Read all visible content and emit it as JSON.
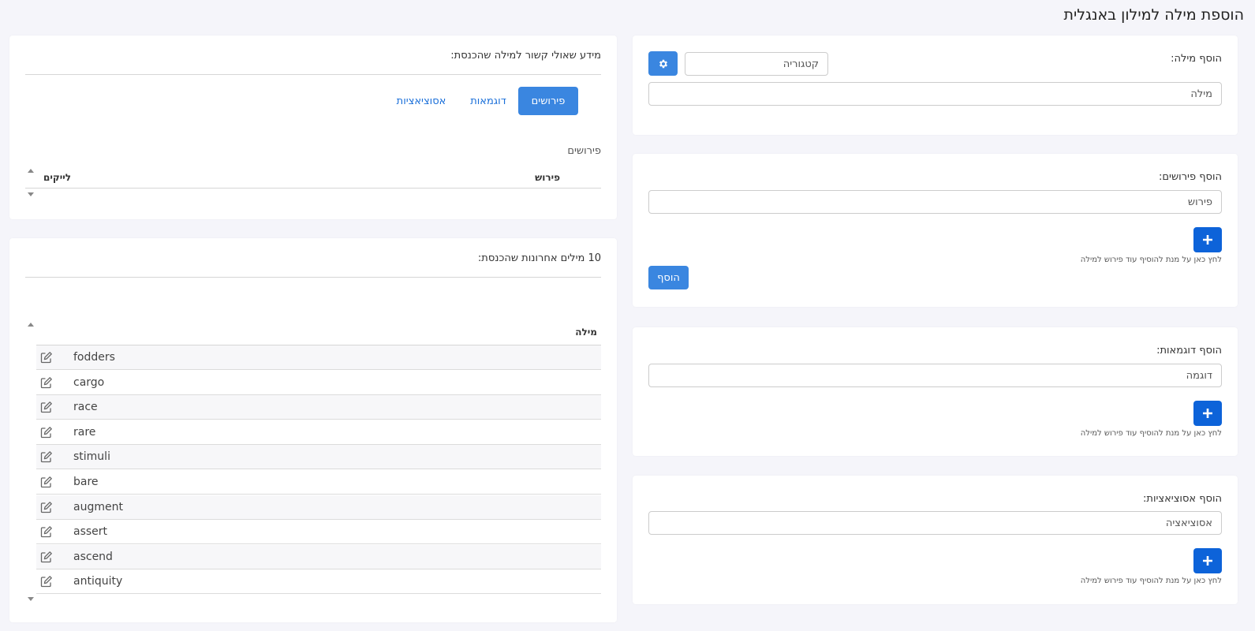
{
  "page_title": "הוספת מילה למילון באנגלית",
  "add_word": {
    "label": "הוסף מילה:",
    "category_placeholder": "קטגוריה",
    "word_placeholder": "מילה"
  },
  "add_definitions": {
    "label": "הוסף פירושים:",
    "placeholder": "פירוש",
    "hint": "לחץ כאן על מנת להוסיף עוד פירוש למילה",
    "add_button": "הוסף"
  },
  "add_examples": {
    "label": "הוסף דוגמאות:",
    "placeholder": "דוגמה",
    "hint": "לחץ כאן על מנת להוסיף עוד פירוש למילה"
  },
  "add_associations": {
    "label": "הוסף אסוציאציות:",
    "placeholder": "אסוציאציה",
    "hint": "לחץ כאן על מנת להוסיף עוד פירוש למילה"
  },
  "related_info": {
    "title": "מידע שאולי קשור למילה שהכנסת:",
    "tabs": [
      "פירושים",
      "דוגמאות",
      "אסוציאציות"
    ],
    "section_label": "פירושים",
    "columns": {
      "definition": "פירוש",
      "likes": "לייקים"
    }
  },
  "recent_words": {
    "title": "10 מילים אחרונות שהכנסת:",
    "column": "מילה",
    "words": [
      "fodders",
      "cargo",
      "race",
      "rare",
      "stimuli",
      "bare",
      "augment",
      "assert",
      "ascend",
      "antiquity"
    ]
  },
  "colors": {
    "primary": "#0d63d9",
    "accent": "#3a86e0",
    "background": "#f5f5fa"
  }
}
